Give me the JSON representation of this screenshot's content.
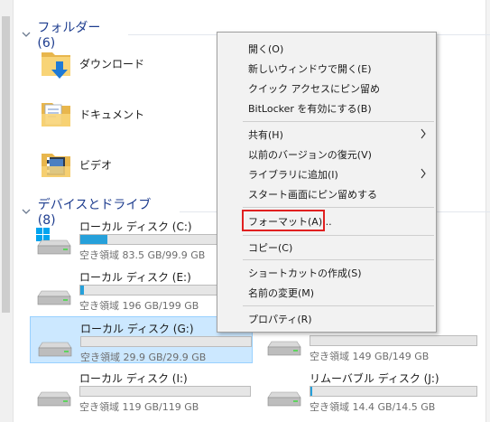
{
  "sections": {
    "folders_header": "フォルダー (6)",
    "devices_header": "デバイスとドライブ (8)"
  },
  "folders": [
    {
      "label": "ダウンロード",
      "icon": "download-folder-icon"
    },
    {
      "label": "ドキュメント",
      "icon": "documents-folder-icon"
    },
    {
      "label": "ビデオ",
      "icon": "videos-folder-icon"
    }
  ],
  "drives": [
    {
      "name": "ローカル ディスク (C:)",
      "free": "空き領域 83.5 GB/99.9 GB",
      "used_fraction": 0.16,
      "icon": "windows-drive-icon"
    },
    {
      "name": "ローカル ディスク (E:)",
      "free": "空き領域 196 GB/199 GB",
      "used_fraction": 0.02,
      "icon": "hard-drive-icon"
    },
    {
      "name": "ローカル ディスク (G:)",
      "free": "空き領域 29.9 GB/29.9 GB",
      "used_fraction": 0.0,
      "icon": "hard-drive-icon"
    },
    {
      "name": "",
      "free": "空き領域 149 GB/149 GB",
      "used_fraction": 0.0,
      "icon": "hard-drive-icon"
    },
    {
      "name": "ローカル ディスク (I:)",
      "free": "空き領域 119 GB/119 GB",
      "used_fraction": 0.0,
      "icon": "hard-drive-icon"
    },
    {
      "name": "リムーバブル ディスク (J:)",
      "free": "空き領域 14.4 GB/14.5 GB",
      "used_fraction": 0.01,
      "icon": "removable-drive-icon"
    }
  ],
  "context_menu": {
    "items": [
      {
        "label": "開く(O)"
      },
      {
        "label": "新しいウィンドウで開く(E)"
      },
      {
        "label": "クイック アクセスにピン留め"
      },
      {
        "label": "BitLocker を有効にする(B)"
      },
      {
        "label": "共有(H)",
        "submenu": true
      },
      {
        "label": "以前のバージョンの復元(V)"
      },
      {
        "label": "ライブラリに追加(I)",
        "submenu": true
      },
      {
        "label": "スタート画面にピン留めする"
      },
      {
        "label": "フォーマット(A)...",
        "highlighted": true
      },
      {
        "label": "コピー(C)"
      },
      {
        "label": "ショートカットの作成(S)"
      },
      {
        "label": "名前の変更(M)"
      },
      {
        "label": "プロパティ(R)"
      }
    ]
  },
  "colors": {
    "section_header": "#1e3d8f",
    "selection": "#cce8ff",
    "usage_bar": "#26a0da",
    "highlight_border": "#e02020"
  }
}
